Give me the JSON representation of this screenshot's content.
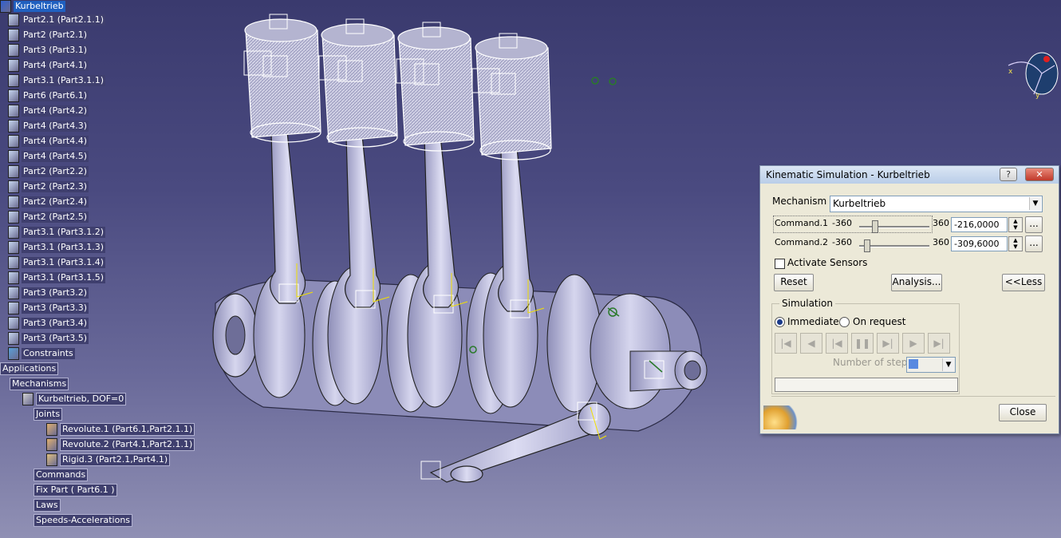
{
  "tree": {
    "items": [
      {
        "label": "Kurbeltrieb",
        "selected": true
      },
      {
        "label": "Part2.1 (Part2.1.1)"
      },
      {
        "label": "Part2 (Part2.1)"
      },
      {
        "label": "Part3 (Part3.1)"
      },
      {
        "label": "Part4 (Part4.1)"
      },
      {
        "label": "Part3.1 (Part3.1.1)"
      },
      {
        "label": "Part6 (Part6.1)"
      },
      {
        "label": "Part4 (Part4.2)"
      },
      {
        "label": "Part4 (Part4.3)"
      },
      {
        "label": "Part4 (Part4.4)"
      },
      {
        "label": "Part4 (Part4.5)"
      },
      {
        "label": "Part2 (Part2.2)"
      },
      {
        "label": "Part2 (Part2.3)"
      },
      {
        "label": "Part2 (Part2.4)"
      },
      {
        "label": "Part2 (Part2.5)"
      },
      {
        "label": "Part3.1 (Part3.1.2)"
      },
      {
        "label": "Part3.1 (Part3.1.3)"
      },
      {
        "label": "Part3.1 (Part3.1.4)"
      },
      {
        "label": "Part3.1 (Part3.1.5)"
      },
      {
        "label": "Part3 (Part3.2)"
      },
      {
        "label": "Part3 (Part3.3)"
      },
      {
        "label": "Part3 (Part3.4)"
      },
      {
        "label": "Part3 (Part3.5)"
      },
      {
        "label": "Constraints"
      },
      {
        "label": "Applications"
      },
      {
        "label": "Mechanisms"
      },
      {
        "label": "Kurbeltrieb, DOF=0"
      },
      {
        "label": "Joints"
      },
      {
        "label": "Revolute.1 (Part6.1,Part2.1.1)"
      },
      {
        "label": "Revolute.2 (Part4.1,Part2.1.1)"
      },
      {
        "label": "Rigid.3 (Part2.1,Part4.1)"
      },
      {
        "label": "Commands"
      },
      {
        "label": "Fix Part ( Part6.1 )"
      },
      {
        "label": "Laws"
      },
      {
        "label": "Speeds-Accelerations"
      }
    ]
  },
  "dialog": {
    "title": "Kinematic Simulation - Kurbeltrieb",
    "help_label": "?",
    "close_x": "✕",
    "mechanism_label": "Mechanism :",
    "mechanism_value": "Kurbeltrieb",
    "commands": [
      {
        "label": "Command.1",
        "min": "-360",
        "max": "360",
        "value": "-216,0000",
        "more": "...",
        "position": 0.2
      },
      {
        "label": "Command.2",
        "min": "-360",
        "max": "360",
        "value": "-309,6000",
        "more": "...",
        "position": 0.07
      }
    ],
    "activate_sensors": "Activate Sensors",
    "reset": "Reset",
    "analysis": "Analysis...",
    "less": "<<Less",
    "simulation_label": "Simulation",
    "immediate": "Immediate",
    "on_request": "On request",
    "steps_label": "Number of steps:",
    "close": "Close"
  },
  "compass": {
    "x_label": "x",
    "y_label": "y"
  }
}
